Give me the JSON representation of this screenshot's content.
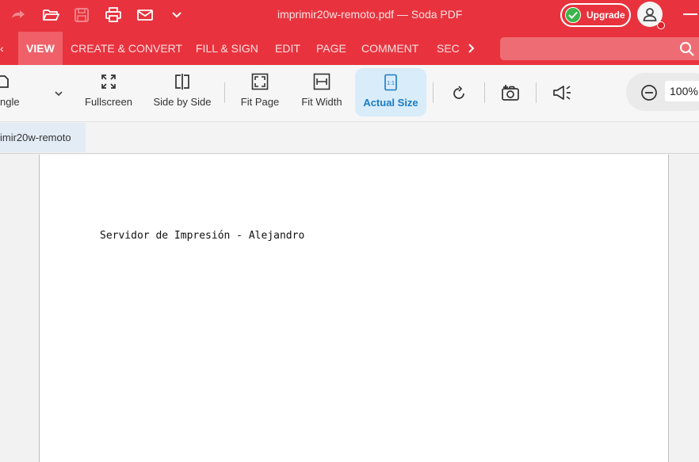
{
  "titlebar": {
    "title": "imprimir20w-remoto.pdf  —  Soda PDF",
    "upgrade_label": "Upgrade",
    "icons": [
      "redo-icon",
      "open-folder-icon",
      "save-icon",
      "print-icon",
      "mail-icon",
      "dropdown-chevron-icon"
    ]
  },
  "menu": {
    "items": [
      {
        "label": "VIEW"
      },
      {
        "label": "CREATE & CONVERT"
      },
      {
        "label": "FILL & SIGN"
      },
      {
        "label": "EDIT"
      },
      {
        "label": "PAGE"
      },
      {
        "label": "COMMENT"
      },
      {
        "label": "SEC"
      }
    ],
    "active": "VIEW"
  },
  "ribbon": {
    "single_label": "ngle",
    "fullscreen_label": "Fullscreen",
    "side_by_side_label": "Side by Side",
    "fit_page_label": "Fit Page",
    "fit_width_label": "Fit Width",
    "actual_size_label": "Actual Size",
    "actual_size_icon_text": "1:1",
    "zoom_value": "100%"
  },
  "tabs": {
    "document_tab": "imir20w-remoto"
  },
  "document": {
    "line1": "Servidor de Impresión - Alejandro"
  },
  "colors": {
    "brand_red": "#e8333e",
    "active_blue": "#1a7bc4",
    "upgrade_green": "#3cb54a"
  }
}
